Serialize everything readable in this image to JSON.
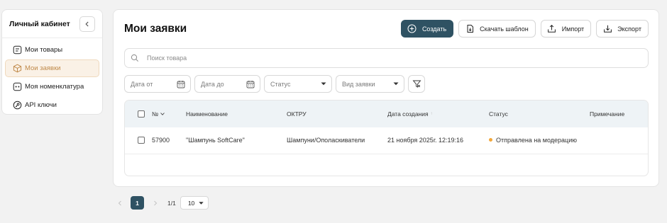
{
  "sidebar": {
    "title": "Личный кабинет",
    "items": [
      {
        "label": "Мои товары",
        "icon": "products-icon",
        "active": false
      },
      {
        "label": "Мои заявки",
        "icon": "box-icon",
        "active": true
      },
      {
        "label": "Моя номенклатура",
        "icon": "catalog-icon",
        "active": false
      },
      {
        "label": "API ключи",
        "icon": "key-icon",
        "active": false
      }
    ]
  },
  "main": {
    "title": "Мои заявки",
    "toolbar": {
      "create": "Создать",
      "download_template": "Скачать шаблон",
      "import": "Импорт",
      "export": "Экспорт"
    },
    "search": {
      "placeholder": "Поиск товара",
      "value": ""
    },
    "filters": {
      "date_from": "Дата от",
      "date_to": "Дата до",
      "status": "Статус",
      "request_type": "Вид заявки"
    },
    "table": {
      "columns": [
        "№",
        "Наименование",
        "ОКТРУ",
        "Дата создания",
        "Статус",
        "Примечание"
      ],
      "rows": [
        {
          "id": "57900",
          "name": "\"Шампунь SoftCare\"",
          "oktru": "Шампуни/Ополаскиватели",
          "created": "21 ноября 2025г. 12:19:16",
          "status": "Отправлена на модерацию",
          "note": ""
        }
      ]
    }
  },
  "pagination": {
    "current": "1",
    "info": "1/1",
    "page_size": "10"
  },
  "colors": {
    "primary": "#2f5263",
    "active_accent": "#c08a4a",
    "status_pending": "#f2a73b"
  }
}
